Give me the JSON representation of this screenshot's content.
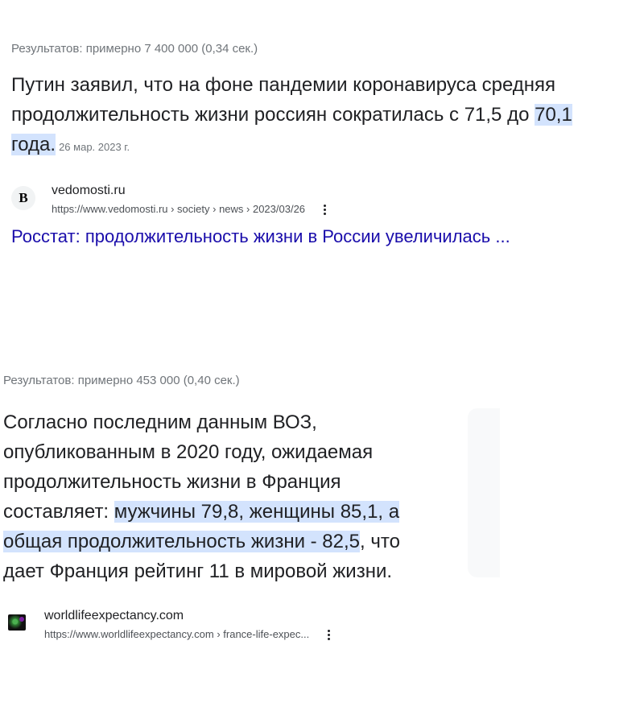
{
  "result1": {
    "stats": "Результатов: примерно 7 400 000 (0,34 сек.)",
    "snippet": {
      "line1": "Путин заявил, что на фоне пандемии коронавируса средняя",
      "line2_pre": "продолжительность жизни россиян сократилась с 71,5 до ",
      "line2_hl": "70,1",
      "line3_hl": "года.",
      "date": "26 мар. 2023 г."
    },
    "source": {
      "favicon_letter": "B",
      "site_name": "vedomosti.ru",
      "url": "https://www.vedomosti.ru › society › news › 2023/03/26"
    },
    "link_title": "Росстат: продолжительность жизни в России увеличилась ..."
  },
  "result2": {
    "stats": "Результатов: примерно 453 000 (0,40 сек.)",
    "snippet": {
      "line1": "Согласно последним данным ВОЗ,",
      "line2": "опубликованным в 2020 году, ожидаемая",
      "line3": "продолжительность жизни в Франция",
      "line4_pre": "составляет: ",
      "line4_hl": "мужчины 79,8, женщины 85,1, а",
      "line5_hl": "общая продолжительность жизни - 82,5",
      "line5_post": ", что",
      "line6": "дает Франция рейтинг 11 в мировой жизни."
    },
    "source": {
      "favicon_icon": "globe-map-icon",
      "site_name": "worldlifeexpectancy.com",
      "url": "https://www.worldlifeexpectancy.com › france-life-expec..."
    }
  },
  "colors": {
    "highlight": "#d3e3fd",
    "link": "#1a0dab",
    "meta_text": "#70757a"
  }
}
